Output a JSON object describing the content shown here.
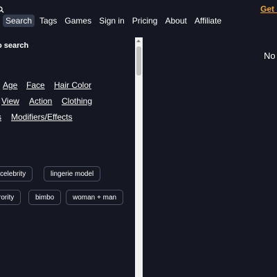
{
  "header": {
    "promo_link": "Get P",
    "nav": [
      {
        "label": "Search",
        "active": true
      },
      {
        "label": "Tags"
      },
      {
        "label": "Games"
      },
      {
        "label": "Sign in"
      },
      {
        "label": "Pricing"
      },
      {
        "label": "About"
      },
      {
        "label": "Affiliate"
      }
    ]
  },
  "left": {
    "section_title": "o search",
    "filters": {
      "row1": [
        "Age",
        "Face",
        "Hair Color"
      ],
      "row2": [
        "View",
        "Action",
        "Clothing"
      ],
      "row3_partial": "s",
      "row3": "Modifiers/Effects"
    },
    "tags": {
      "row1": [
        "celebrity",
        "lingerie model"
      ],
      "row2": [
        "rority",
        "bimbo",
        "woman + man"
      ]
    }
  },
  "right": {
    "partial_text": "No"
  },
  "colors": {
    "background": "#151823",
    "accent": "#f5a524",
    "active_nav": "#333a4b",
    "tag_border": "#4a5162"
  },
  "icons": {
    "logo": "search-logo-icon"
  }
}
